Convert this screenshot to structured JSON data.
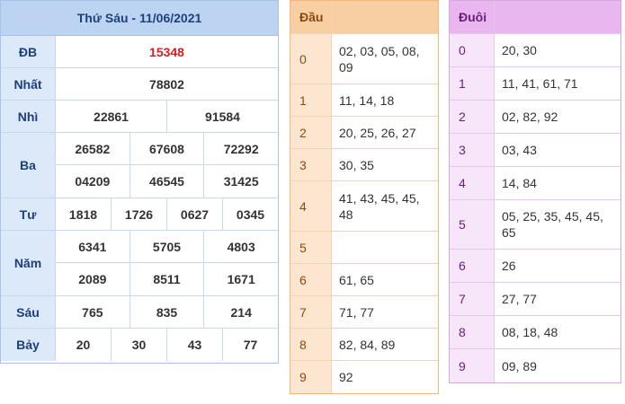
{
  "results": {
    "title": "Thứ Sáu - 11/06/2021",
    "prizes": [
      {
        "label": "ĐB",
        "lines": [
          [
            "15348"
          ]
        ],
        "special": true
      },
      {
        "label": "Nhất",
        "lines": [
          [
            "78802"
          ]
        ]
      },
      {
        "label": "Nhì",
        "lines": [
          [
            "22861",
            "91584"
          ]
        ]
      },
      {
        "label": "Ba",
        "lines": [
          [
            "26582",
            "67608",
            "72292"
          ],
          [
            "04209",
            "46545",
            "31425"
          ]
        ]
      },
      {
        "label": "Tư",
        "lines": [
          [
            "1818",
            "1726",
            "0627",
            "0345"
          ]
        ]
      },
      {
        "label": "Năm",
        "lines": [
          [
            "6341",
            "5705",
            "4803"
          ],
          [
            "2089",
            "8511",
            "1671"
          ]
        ]
      },
      {
        "label": "Sáu",
        "lines": [
          [
            "765",
            "835",
            "214"
          ]
        ]
      },
      {
        "label": "Bảy",
        "lines": [
          [
            "20",
            "30",
            "43",
            "77"
          ]
        ]
      }
    ]
  },
  "dau": {
    "header": "Đầu",
    "rows": [
      {
        "key": "0",
        "value": "02, 03, 05, 08, 09",
        "tall": true
      },
      {
        "key": "1",
        "value": "11, 14, 18"
      },
      {
        "key": "2",
        "value": "20, 25, 26, 27"
      },
      {
        "key": "3",
        "value": "30, 35"
      },
      {
        "key": "4",
        "value": "41, 43, 45, 45, 48",
        "tall": true
      },
      {
        "key": "5",
        "value": ""
      },
      {
        "key": "6",
        "value": "61, 65"
      },
      {
        "key": "7",
        "value": "71, 77"
      },
      {
        "key": "8",
        "value": "82, 84, 89"
      },
      {
        "key": "9",
        "value": "92"
      }
    ]
  },
  "duoi": {
    "header": "Đuôi",
    "rows": [
      {
        "key": "0",
        "value": "20, 30"
      },
      {
        "key": "1",
        "value": "11, 41, 61, 71"
      },
      {
        "key": "2",
        "value": "02, 82, 92"
      },
      {
        "key": "3",
        "value": "03, 43"
      },
      {
        "key": "4",
        "value": "14, 84"
      },
      {
        "key": "5",
        "value": "05, 25, 35, 45, 45, 65",
        "tall": true
      },
      {
        "key": "6",
        "value": "26"
      },
      {
        "key": "7",
        "value": "27, 77"
      },
      {
        "key": "8",
        "value": "08, 18, 48"
      },
      {
        "key": "9",
        "value": "09, 89"
      }
    ]
  },
  "colors": {
    "special_number": "#d32020",
    "results_header": "#bcd4f2",
    "dau_accent": "#f8cfa3",
    "duoi_accent": "#e9b6f0"
  }
}
